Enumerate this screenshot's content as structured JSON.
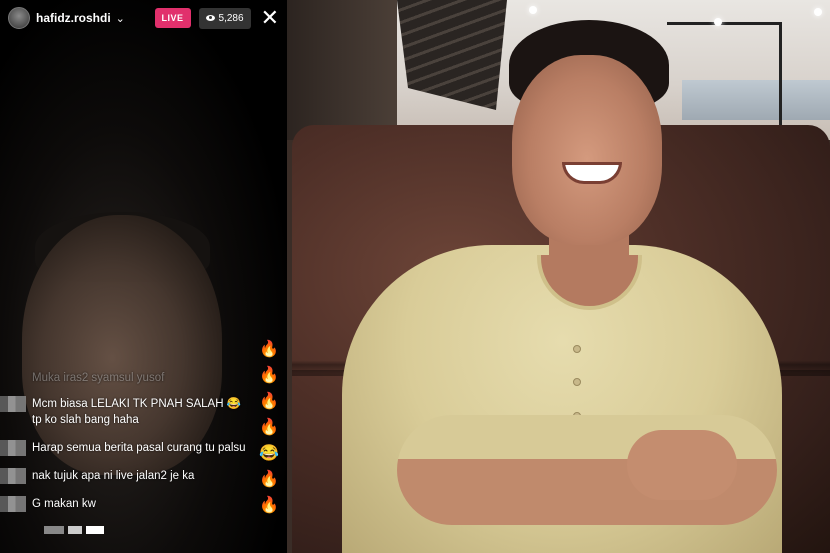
{
  "live": {
    "username": "hafidz.roshdi",
    "live_label": "LIVE",
    "viewer_count": "5,286",
    "icons": {
      "avatar": "profile-avatar",
      "dropdown": "chevron-down-icon",
      "viewers": "eye-icon",
      "close": "close-icon"
    },
    "comments": [
      {
        "text": "Muka iras2 syamsul yusof",
        "faded": true
      },
      {
        "text": "Mcm biasa LELAKI TK PNAH SALAH 😂 tp ko slah bang haha",
        "faded": false
      },
      {
        "text": "Harap semua berita pasal curang tu palsu",
        "faded": false
      },
      {
        "text": "nak tujuk apa ni live jalan2 je ka",
        "faded": false
      },
      {
        "text": "G makan kw",
        "faded": false
      }
    ],
    "reactions": [
      "🔥",
      "🔥",
      "🔥",
      "🔥",
      "😂",
      "🔥",
      "🔥"
    ]
  },
  "colors": {
    "live_badge": "#e1306c",
    "shirt": "#d9cc98",
    "booth_leather": "#4e2f27"
  }
}
